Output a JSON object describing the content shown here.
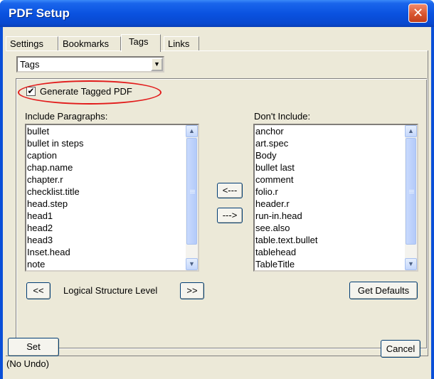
{
  "window": {
    "title": "PDF Setup",
    "close_glyph": "✕"
  },
  "tabs": [
    {
      "label": "Settings",
      "active": false
    },
    {
      "label": "Bookmarks",
      "active": false
    },
    {
      "label": "Tags",
      "active": true
    },
    {
      "label": "Links",
      "active": false
    }
  ],
  "combo": {
    "value": "Tags",
    "arrow_glyph": "▼"
  },
  "generate_tagged": {
    "label": "Generate Tagged PDF",
    "checked": true,
    "check_glyph": "✔"
  },
  "include": {
    "label": "Include Paragraphs:",
    "items": [
      "bullet",
      "bullet in steps",
      "caption",
      "chap.name",
      "chapter.r",
      "checklist.title",
      "head.step",
      "head1",
      "head2",
      "head3",
      "Inset.head",
      "note"
    ]
  },
  "exclude": {
    "label": "Don't Include:",
    "items": [
      "anchor",
      "art.spec",
      "Body",
      "bullet last",
      "comment",
      "folio.r",
      "header.r",
      "run-in.head",
      "see.also",
      "table.text.bullet",
      "tablehead",
      "TableTitle"
    ]
  },
  "buttons": {
    "move_left": "<---",
    "move_right": "--->",
    "level_down": "<<",
    "level_up": ">>",
    "logical_structure": "Logical Structure Level",
    "get_defaults": "Get Defaults",
    "set": "Set",
    "cancel": "Cancel"
  },
  "no_undo": "(No Undo)",
  "scroll_glyphs": {
    "up": "▲",
    "down": "▼",
    "grip": "≡"
  },
  "colors": {
    "title_blue": "#0a52e0",
    "close_red": "#d9552f",
    "highlight_red": "#e21b1b",
    "dialog_bg": "#ece9d8"
  }
}
